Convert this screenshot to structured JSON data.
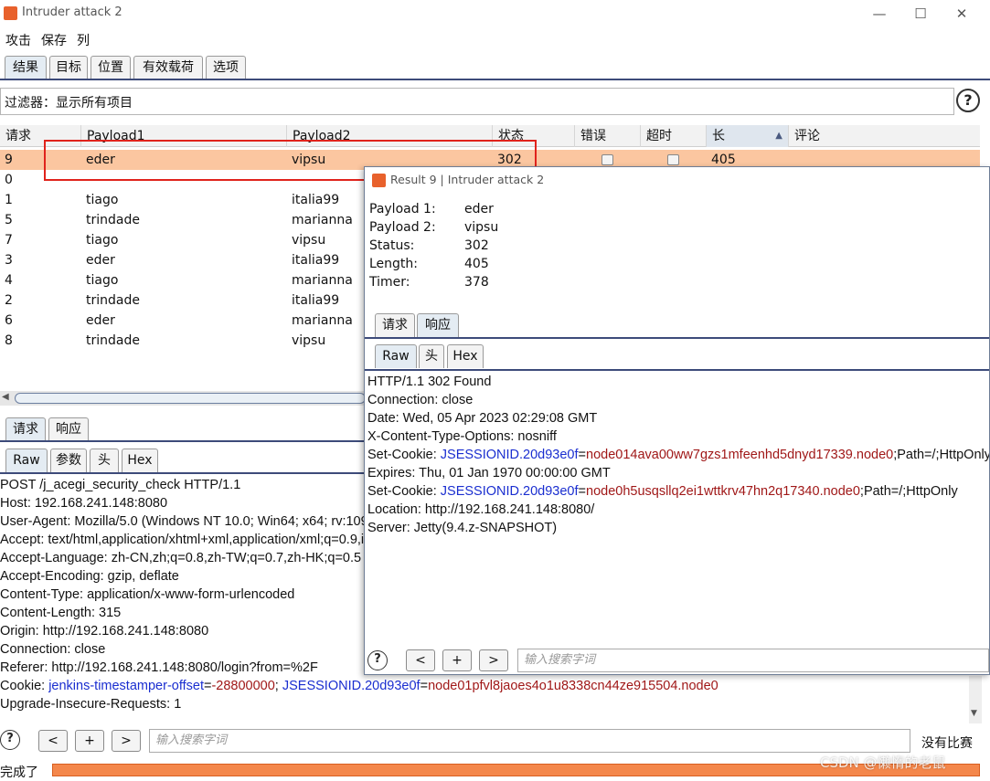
{
  "window": {
    "title": "Intruder attack 2",
    "controls": [
      "—",
      "☐",
      "✕"
    ]
  },
  "menu": [
    "攻击",
    "保存",
    "列"
  ],
  "main_tabs": [
    "结果",
    "目标",
    "位置",
    "有效载荷",
    "选项"
  ],
  "filter": {
    "label": "过滤器：",
    "value": "显示所有项目"
  },
  "table": {
    "columns": [
      "请求",
      "Payload1",
      "Payload2",
      "状态",
      "错误",
      "超时",
      "长",
      "评论"
    ],
    "sort_indicator": "▲",
    "rows": [
      {
        "req": "9",
        "p1": "eder",
        "p2": "vipsu",
        "status": "302",
        "length": "405",
        "selected": true
      },
      {
        "req": "0",
        "p1": "",
        "p2": ""
      },
      {
        "req": "1",
        "p1": "tiago",
        "p2": "italia99"
      },
      {
        "req": "5",
        "p1": "trindade",
        "p2": "marianna"
      },
      {
        "req": "7",
        "p1": "tiago",
        "p2": "vipsu"
      },
      {
        "req": "3",
        "p1": "eder",
        "p2": "italia99"
      },
      {
        "req": "4",
        "p1": "tiago",
        "p2": "marianna"
      },
      {
        "req": "2",
        "p1": "trindade",
        "p2": "italia99"
      },
      {
        "req": "6",
        "p1": "eder",
        "p2": "marianna"
      },
      {
        "req": "8",
        "p1": "trindade",
        "p2": "vipsu"
      }
    ]
  },
  "lower_tabs": [
    "请求",
    "响应"
  ],
  "view_tabs": [
    "Raw",
    "参数",
    "头",
    "Hex"
  ],
  "request_lines": [
    "POST /j_acegi_security_check HTTP/1.1",
    "Host: 192.168.241.148:8080",
    "User-Agent: Mozilla/5.0 (Windows NT 10.0; Win64; x64; rv:109",
    "Accept: text/html,application/xhtml+xml,application/xml;q=0.9,i",
    "Accept-Language: zh-CN,zh;q=0.8,zh-TW;q=0.7,zh-HK;q=0.5",
    "Accept-Encoding: gzip, deflate",
    "Content-Type: application/x-www-form-urlencoded",
    "Content-Length: 315",
    "Origin: http://192.168.241.148:8080",
    "Connection: close",
    "Referer: http://192.168.241.148:8080/login?from=%2F"
  ],
  "cookie_line": {
    "prefix": "Cookie: ",
    "name1": "jenkins-timestamper-offset",
    "eq1": "=",
    "val1": "-28800000",
    "sep": "; ",
    "name2": "JSESSIONID.20d93e0f",
    "eq2": "=",
    "val2": "node01pfvl8jaoes4o1u8338cn44ze915504.node0"
  },
  "request_last": "Upgrade-Insecure-Requests: 1",
  "bottom": {
    "help": "?",
    "prev": "<",
    "add": "+",
    "next": ">",
    "search_placeholder": "输入搜索字词",
    "match": "没有比赛"
  },
  "status": {
    "text": "完成了",
    "progress": 1.0,
    "watermark": "CSDN @懒惰的老鼠"
  },
  "popup": {
    "title": "Result 9 | Intruder attack 2",
    "fields": [
      {
        "k": "Payload 1:",
        "v": "eder"
      },
      {
        "k": "Payload 2:",
        "v": "vipsu"
      },
      {
        "k": "Status:",
        "v": "302"
      },
      {
        "k": "Length:",
        "v": "405"
      },
      {
        "k": "Timer:",
        "v": "378"
      }
    ],
    "tabs": [
      "请求",
      "响应"
    ],
    "view_tabs": [
      "Raw",
      "头",
      "Hex"
    ],
    "response_lines_a": [
      "HTTP/1.1 302 Found",
      "Connection: close",
      "Date: Wed, 05 Apr 2023 02:29:08 GMT",
      "X-Content-Type-Options: nosniff"
    ],
    "cookie1": {
      "prefix": "Set-Cookie: ",
      "name": "JSESSIONID.20d93e0f",
      "eq": "=",
      "val": "node014ava00ww7gzs1mfeenhd5dnyd17339.node0",
      "suffix": ";Path=/;HttpOnly"
    },
    "expires": "Expires: Thu, 01 Jan 1970 00:00:00 GMT",
    "cookie2": {
      "prefix": "Set-Cookie: ",
      "name": "JSESSIONID.20d93e0f",
      "eq": "=",
      "val": "node0h5usqsllq2ei1wttkrv47hn2q17340.node0",
      "suffix": ";Path=/;HttpOnly"
    },
    "response_lines_b": [
      "Location: http://192.168.241.148:8080/",
      "Server: Jetty(9.4.z-SNAPSHOT)"
    ],
    "search_placeholder": "输入搜索字词"
  },
  "colors": {
    "selected_row": "#fbc6a0",
    "highlight_box": "#e0231c",
    "progress": "#f4874b",
    "cookie_name": "#1a2ed0",
    "cookie_value": "#a01818"
  }
}
